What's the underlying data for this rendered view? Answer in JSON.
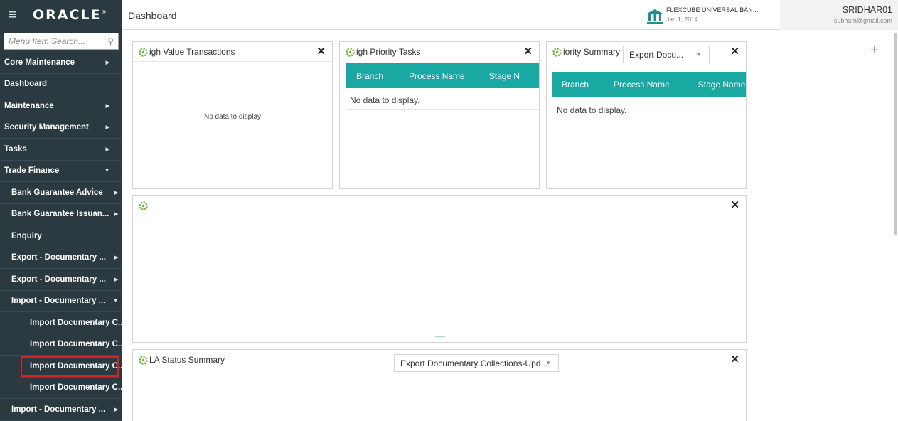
{
  "sidebar": {
    "logo": "ORACLE",
    "logo_mark": "®",
    "search_placeholder": "Menu Item Search...",
    "items": [
      {
        "label": "Core Maintenance",
        "arrow": "▶"
      },
      {
        "label": "Dashboard",
        "arrow": ""
      },
      {
        "label": "Maintenance",
        "arrow": "▶"
      },
      {
        "label": "Security Management",
        "arrow": "▶"
      },
      {
        "label": "Tasks",
        "arrow": "▶"
      },
      {
        "label": "Trade Finance",
        "arrow": "▼"
      },
      {
        "label": "Bank Guarantee Advice",
        "arrow": "▶"
      },
      {
        "label": "Bank Guarantee Issuan...",
        "arrow": "▶"
      },
      {
        "label": "Enquiry",
        "arrow": ""
      },
      {
        "label": "Export - Documentary ...",
        "arrow": "▶"
      },
      {
        "label": "Export - Documentary ...",
        "arrow": "▶"
      },
      {
        "label": "Import - Documentary ...",
        "arrow": "▼"
      },
      {
        "label": "Import Documentary C...",
        "arrow": ""
      },
      {
        "label": "Import Documentary C...",
        "arrow": ""
      },
      {
        "label": "Import Documentary C...",
        "arrow": ""
      },
      {
        "label": "Import Documentary C...",
        "arrow": ""
      },
      {
        "label": "Import - Documentary ...",
        "arrow": "▶"
      }
    ]
  },
  "header": {
    "title": "Dashboard",
    "bank_name": "FLEXCUBE UNIVERSAL BAN...",
    "date": "Jan 1, 2014",
    "user": "SRIDHAR01",
    "email": "subham@gmail.com"
  },
  "widgets": {
    "hvt": {
      "title": "igh Value Transactions",
      "nodata": "No data to display"
    },
    "hpt": {
      "title": "igh Priority Tasks",
      "cols": [
        "Branch",
        "Process Name",
        "Stage N"
      ],
      "nodata": "No data to display."
    },
    "ps": {
      "title": "iority Summary",
      "select": "Export Docu...",
      "cols": [
        "Branch",
        "Process Name",
        "Stage Name"
      ],
      "nodata": "No data to display."
    },
    "sla": {
      "title": "LA Status Summary",
      "select": "Export Documentary Collections-Upd..."
    }
  },
  "glyphs": {
    "close": "✕",
    "caret": "▼",
    "plus": "+",
    "hamburger": "≡",
    "search": "⚲"
  },
  "colors": {
    "sidebar": "#2b3a40",
    "teal": "#1aa8a3",
    "highlight": "#d92121",
    "gear": "#6db33f"
  }
}
